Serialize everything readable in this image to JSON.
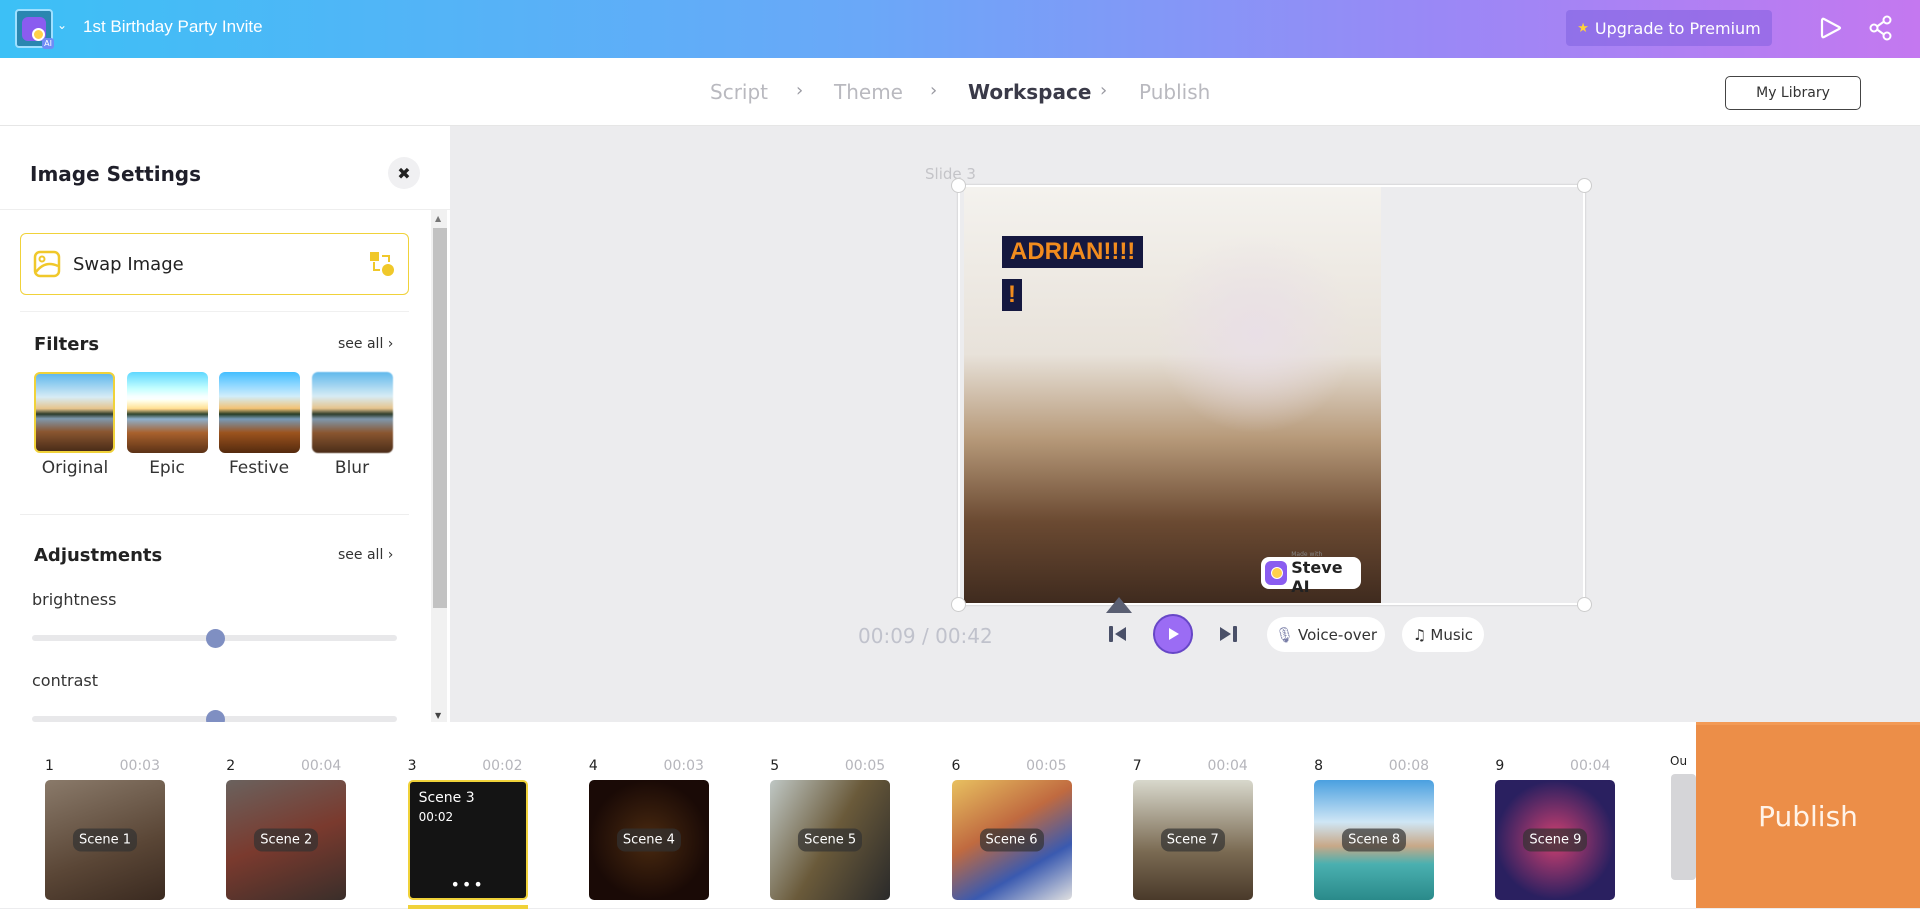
{
  "header": {
    "project_title": "1st Birthday Party Invite",
    "logo_badge": "AI",
    "upgrade_label": "Upgrade to Premium",
    "icons": [
      "star-icon",
      "play-preview-icon",
      "share-icon"
    ]
  },
  "steps": [
    {
      "label": "Script"
    },
    {
      "label": "Theme"
    },
    {
      "label": "Workspace",
      "active": true
    },
    {
      "label": "Publish"
    }
  ],
  "my_library": "My Library",
  "panel": {
    "title": "Image Settings",
    "close": "✖",
    "swap_label": "Swap Image",
    "filters_title": "Filters",
    "filters_see_all": "see all",
    "filters": [
      {
        "label": "Original",
        "selected": true
      },
      {
        "label": "Epic"
      },
      {
        "label": "Festive"
      },
      {
        "label": "Blur"
      }
    ],
    "adjustments_title": "Adjustments",
    "adjustments_see_all": "see all",
    "sliders": [
      {
        "label": "brightness",
        "value": 0.5
      },
      {
        "label": "contrast",
        "value": 0.5
      }
    ]
  },
  "canvas": {
    "slide_label": "Slide 3",
    "text_line1": "ADRIAN!!!!",
    "text_line2": "!",
    "watermark_small": "Made with",
    "watermark": "Steve AI"
  },
  "player": {
    "timecode": "00:09 / 00:42",
    "voiceover": "Voice-over",
    "music": "Music"
  },
  "scenes": [
    {
      "num": "1",
      "dur": "00:03",
      "label": "Scene 1"
    },
    {
      "num": "2",
      "dur": "00:04",
      "label": "Scene 2"
    },
    {
      "num": "3",
      "dur": "00:02",
      "label": "Scene 3",
      "active": true,
      "more": "•••"
    },
    {
      "num": "4",
      "dur": "00:03",
      "label": "Scene 4"
    },
    {
      "num": "5",
      "dur": "00:05",
      "label": "Scene 5"
    },
    {
      "num": "6",
      "dur": "00:05",
      "label": "Scene 6"
    },
    {
      "num": "7",
      "dur": "00:04",
      "label": "Scene 7"
    },
    {
      "num": "8",
      "dur": "00:08",
      "label": "Scene 8"
    },
    {
      "num": "9",
      "dur": "00:04",
      "label": "Scene 9"
    }
  ],
  "outro_label": "Ou",
  "publish_label": "Publish",
  "colors": {
    "accent_purple": "#9b6cf4",
    "publish_orange": "#ec8e48",
    "highlight_yellow": "#f0d23a",
    "text_overlay_bg": "#15183f",
    "text_overlay_fg": "#f28c1e"
  }
}
